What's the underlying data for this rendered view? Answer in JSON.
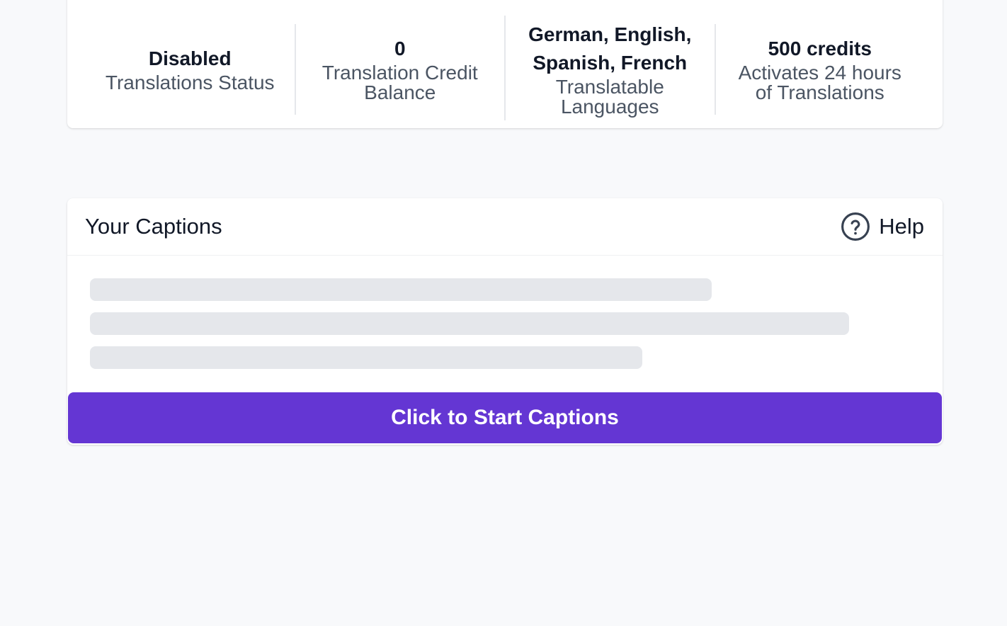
{
  "stats": {
    "status_value": "Disabled",
    "status_label": "Translations Status",
    "credit_value": "0",
    "credit_label": "Translation Credit Balance",
    "languages_value": "German, English, Spanish, French",
    "languages_label": "Translatable Languages",
    "offer_value": "500 credits",
    "offer_label": "Activates 24 hours of Translations"
  },
  "captions": {
    "title": "Your Captions",
    "help_label": "Help",
    "help_icon": "question-circle-icon",
    "start_button_label": "Click to Start Captions",
    "accent_color": "#6436d3"
  }
}
